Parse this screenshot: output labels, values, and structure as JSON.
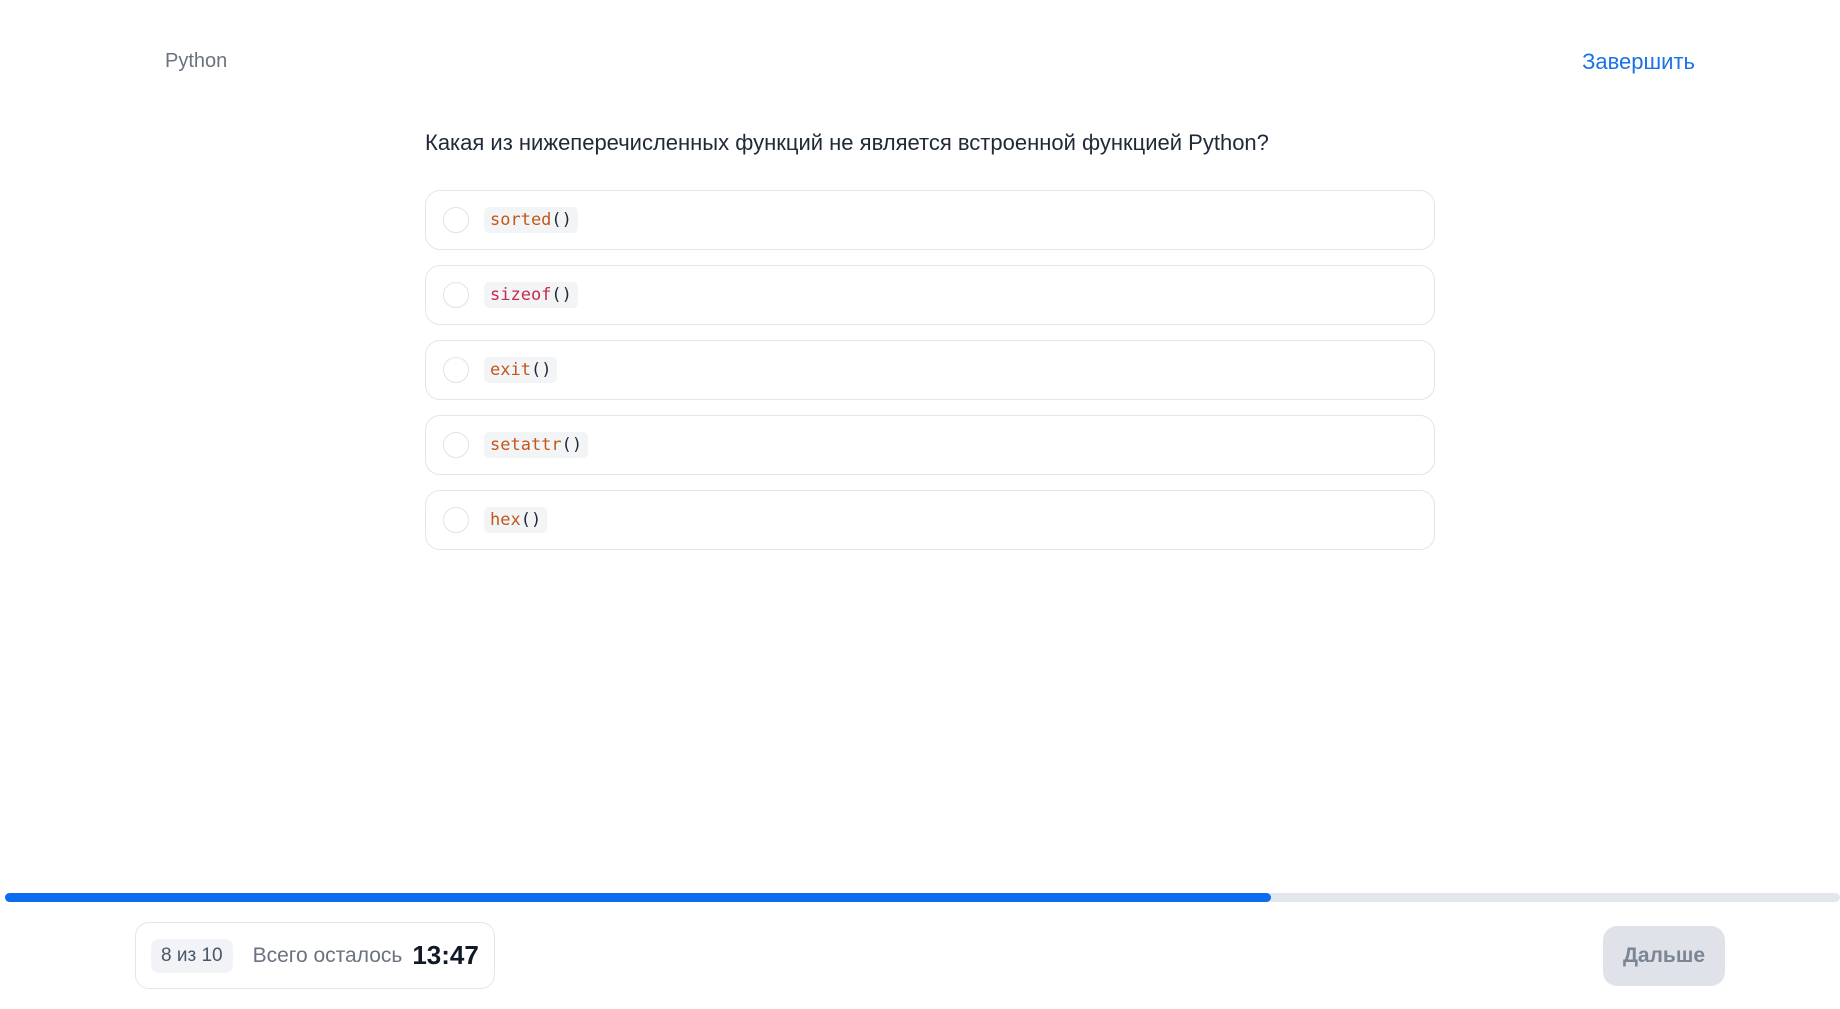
{
  "header": {
    "topic": "Python",
    "finish_label": "Завершить"
  },
  "question": {
    "text": "Какая из нижеперечисленных функций не является встроенной функцией Python?"
  },
  "options": [
    {
      "name": "sorted",
      "parens": "()",
      "color": "#c2571a"
    },
    {
      "name": "sizeof",
      "parens": "()",
      "color": "#c72a4a"
    },
    {
      "name": "exit",
      "parens": "()",
      "color": "#c2571a"
    },
    {
      "name": "setattr",
      "parens": "()",
      "color": "#c2571a"
    },
    {
      "name": "hex",
      "parens": "()",
      "color": "#c2571a"
    }
  ],
  "progress": {
    "fraction": 0.69,
    "fill_color": "#0a6cf0",
    "track_color": "#e3e7ed"
  },
  "footer": {
    "counter": "8 из 10",
    "remaining_label": "Всего осталось",
    "timer": "13:47",
    "next_label": "Дальше"
  }
}
